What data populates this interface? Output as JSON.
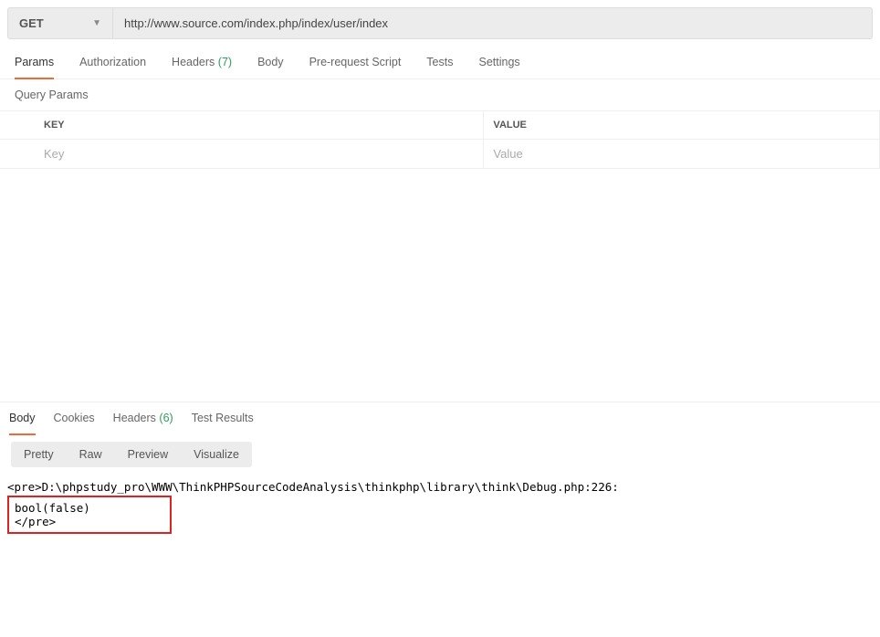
{
  "request": {
    "method": "GET",
    "url": "http://www.source.com/index.php/index/user/index"
  },
  "tabs": {
    "params": "Params",
    "authorization": "Authorization",
    "headers": "Headers",
    "headers_count": "(7)",
    "body": "Body",
    "prerequest": "Pre-request Script",
    "tests": "Tests",
    "settings": "Settings"
  },
  "query_params": {
    "section_label": "Query Params",
    "key_header": "KEY",
    "value_header": "VALUE",
    "key_placeholder": "Key",
    "value_placeholder": "Value"
  },
  "response_tabs": {
    "body": "Body",
    "cookies": "Cookies",
    "headers": "Headers",
    "headers_count": "(6)",
    "test_results": "Test Results"
  },
  "view_modes": {
    "pretty": "Pretty",
    "raw": "Raw",
    "preview": "Preview",
    "visualize": "Visualize"
  },
  "response_body": {
    "line1": "<pre>D:\\phpstudy_pro\\WWW\\ThinkPHPSourceCodeAnalysis\\thinkphp\\library\\think\\Debug.php:226:",
    "line2": "bool(false)",
    "line3": "</pre>"
  }
}
